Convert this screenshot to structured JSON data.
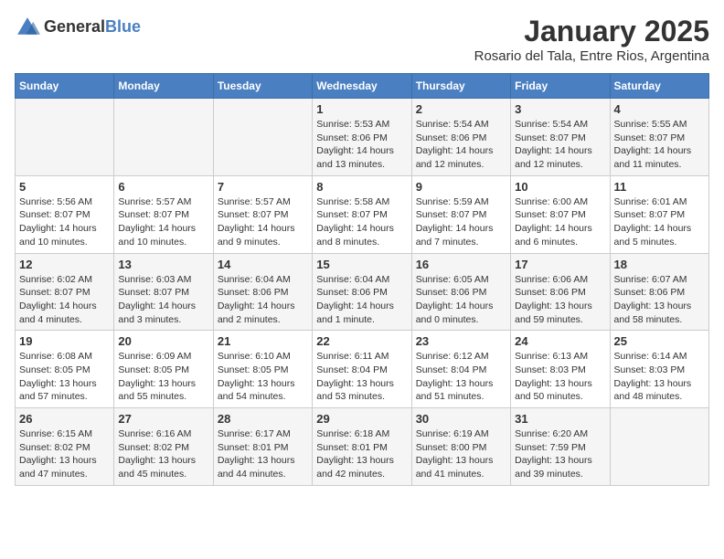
{
  "header": {
    "logo": {
      "general": "General",
      "blue": "Blue"
    },
    "title": "January 2025",
    "subtitle": "Rosario del Tala, Entre Rios, Argentina"
  },
  "weekdays": [
    "Sunday",
    "Monday",
    "Tuesday",
    "Wednesday",
    "Thursday",
    "Friday",
    "Saturday"
  ],
  "weeks": [
    [
      {
        "day": "",
        "detail": ""
      },
      {
        "day": "",
        "detail": ""
      },
      {
        "day": "",
        "detail": ""
      },
      {
        "day": "1",
        "detail": "Sunrise: 5:53 AM\nSunset: 8:06 PM\nDaylight: 14 hours\nand 13 minutes."
      },
      {
        "day": "2",
        "detail": "Sunrise: 5:54 AM\nSunset: 8:06 PM\nDaylight: 14 hours\nand 12 minutes."
      },
      {
        "day": "3",
        "detail": "Sunrise: 5:54 AM\nSunset: 8:07 PM\nDaylight: 14 hours\nand 12 minutes."
      },
      {
        "day": "4",
        "detail": "Sunrise: 5:55 AM\nSunset: 8:07 PM\nDaylight: 14 hours\nand 11 minutes."
      }
    ],
    [
      {
        "day": "5",
        "detail": "Sunrise: 5:56 AM\nSunset: 8:07 PM\nDaylight: 14 hours\nand 10 minutes."
      },
      {
        "day": "6",
        "detail": "Sunrise: 5:57 AM\nSunset: 8:07 PM\nDaylight: 14 hours\nand 10 minutes."
      },
      {
        "day": "7",
        "detail": "Sunrise: 5:57 AM\nSunset: 8:07 PM\nDaylight: 14 hours\nand 9 minutes."
      },
      {
        "day": "8",
        "detail": "Sunrise: 5:58 AM\nSunset: 8:07 PM\nDaylight: 14 hours\nand 8 minutes."
      },
      {
        "day": "9",
        "detail": "Sunrise: 5:59 AM\nSunset: 8:07 PM\nDaylight: 14 hours\nand 7 minutes."
      },
      {
        "day": "10",
        "detail": "Sunrise: 6:00 AM\nSunset: 8:07 PM\nDaylight: 14 hours\nand 6 minutes."
      },
      {
        "day": "11",
        "detail": "Sunrise: 6:01 AM\nSunset: 8:07 PM\nDaylight: 14 hours\nand 5 minutes."
      }
    ],
    [
      {
        "day": "12",
        "detail": "Sunrise: 6:02 AM\nSunset: 8:07 PM\nDaylight: 14 hours\nand 4 minutes."
      },
      {
        "day": "13",
        "detail": "Sunrise: 6:03 AM\nSunset: 8:07 PM\nDaylight: 14 hours\nand 3 minutes."
      },
      {
        "day": "14",
        "detail": "Sunrise: 6:04 AM\nSunset: 8:06 PM\nDaylight: 14 hours\nand 2 minutes."
      },
      {
        "day": "15",
        "detail": "Sunrise: 6:04 AM\nSunset: 8:06 PM\nDaylight: 14 hours\nand 1 minute."
      },
      {
        "day": "16",
        "detail": "Sunrise: 6:05 AM\nSunset: 8:06 PM\nDaylight: 14 hours\nand 0 minutes."
      },
      {
        "day": "17",
        "detail": "Sunrise: 6:06 AM\nSunset: 8:06 PM\nDaylight: 13 hours\nand 59 minutes."
      },
      {
        "day": "18",
        "detail": "Sunrise: 6:07 AM\nSunset: 8:06 PM\nDaylight: 13 hours\nand 58 minutes."
      }
    ],
    [
      {
        "day": "19",
        "detail": "Sunrise: 6:08 AM\nSunset: 8:05 PM\nDaylight: 13 hours\nand 57 minutes."
      },
      {
        "day": "20",
        "detail": "Sunrise: 6:09 AM\nSunset: 8:05 PM\nDaylight: 13 hours\nand 55 minutes."
      },
      {
        "day": "21",
        "detail": "Sunrise: 6:10 AM\nSunset: 8:05 PM\nDaylight: 13 hours\nand 54 minutes."
      },
      {
        "day": "22",
        "detail": "Sunrise: 6:11 AM\nSunset: 8:04 PM\nDaylight: 13 hours\nand 53 minutes."
      },
      {
        "day": "23",
        "detail": "Sunrise: 6:12 AM\nSunset: 8:04 PM\nDaylight: 13 hours\nand 51 minutes."
      },
      {
        "day": "24",
        "detail": "Sunrise: 6:13 AM\nSunset: 8:03 PM\nDaylight: 13 hours\nand 50 minutes."
      },
      {
        "day": "25",
        "detail": "Sunrise: 6:14 AM\nSunset: 8:03 PM\nDaylight: 13 hours\nand 48 minutes."
      }
    ],
    [
      {
        "day": "26",
        "detail": "Sunrise: 6:15 AM\nSunset: 8:02 PM\nDaylight: 13 hours\nand 47 minutes."
      },
      {
        "day": "27",
        "detail": "Sunrise: 6:16 AM\nSunset: 8:02 PM\nDaylight: 13 hours\nand 45 minutes."
      },
      {
        "day": "28",
        "detail": "Sunrise: 6:17 AM\nSunset: 8:01 PM\nDaylight: 13 hours\nand 44 minutes."
      },
      {
        "day": "29",
        "detail": "Sunrise: 6:18 AM\nSunset: 8:01 PM\nDaylight: 13 hours\nand 42 minutes."
      },
      {
        "day": "30",
        "detail": "Sunrise: 6:19 AM\nSunset: 8:00 PM\nDaylight: 13 hours\nand 41 minutes."
      },
      {
        "day": "31",
        "detail": "Sunrise: 6:20 AM\nSunset: 7:59 PM\nDaylight: 13 hours\nand 39 minutes."
      },
      {
        "day": "",
        "detail": ""
      }
    ]
  ]
}
